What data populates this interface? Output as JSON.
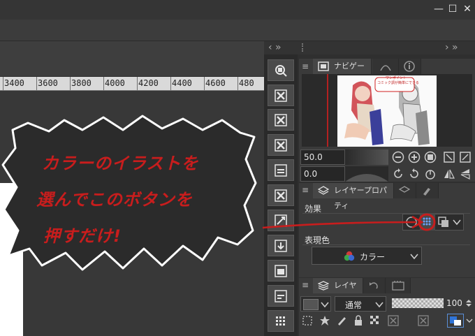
{
  "window": {
    "minimize_glyph": "—",
    "maximize_glyph": "☐",
    "close_glyph": "✕"
  },
  "ruler": {
    "labels": [
      "3400",
      "3600",
      "3800",
      "4000",
      "4200",
      "4400",
      "4600",
      "480"
    ]
  },
  "panel_header": {
    "left_arrows": "‹  »",
    "right_arrows": "›  »"
  },
  "navigator": {
    "tab_label": "ナビゲーター",
    "thumbnail_caption": "ワンポイント\nコミック調が簡単にできる",
    "zoom_value": "50.0",
    "rotation_value": "0.0"
  },
  "layer_property": {
    "tab_label": "レイヤープロパティ",
    "effect_label": "効果",
    "expression_color_label": "表現色",
    "color_mode_value": "カラー"
  },
  "layer_panel": {
    "tab_label": "レイヤー",
    "blend_mode_value": "通常",
    "opacity_value": "100"
  },
  "annotation": {
    "line1": "カラーのイラストを",
    "line2": "選んでこのボタンを",
    "line3": "押すだけ!",
    "color": "#c81d1d"
  },
  "icons": {
    "tool_buttons": [
      "zoom-fit-icon",
      "layer-x-icon",
      "layer-x-icon",
      "layer-x-icon",
      "layer-panel-icon",
      "layer-x-icon",
      "layer-transform-icon",
      "download-icon",
      "image-icon",
      "layer-grid-icon",
      "grid-icon"
    ]
  }
}
